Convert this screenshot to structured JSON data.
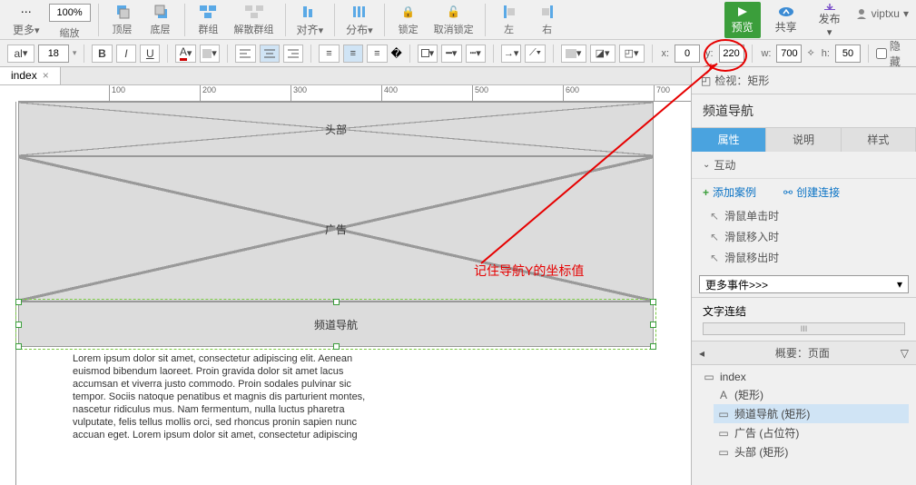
{
  "zoom": "100%",
  "top_toolbar": {
    "more": "更多",
    "scale": "缩放",
    "top": "顶层",
    "bottom": "底层",
    "group": "群组",
    "ungroup": "解散群组",
    "align": "对齐",
    "distribute": "分布",
    "lock": "锁定",
    "unlock": "取消锁定",
    "left": "左",
    "right": "右",
    "preview": "预览",
    "share": "共享",
    "publish": "发布"
  },
  "user": {
    "name": "viptxu"
  },
  "format_bar": {
    "font_style": "al",
    "font_size": "18",
    "x": "0",
    "y": "220",
    "w": "700",
    "h": "50",
    "hide": "隐藏"
  },
  "tab": {
    "name": "index"
  },
  "ruler_ticks": [
    "100",
    "200",
    "300",
    "400",
    "500",
    "600",
    "700"
  ],
  "shapes": {
    "header": "头部",
    "ad": "广告",
    "nav": "频道导航"
  },
  "lorem": "Lorem ipsum dolor sit amet, consectetur adipiscing elit. Aenean euismod bibendum laoreet. Proin gravida dolor sit amet lacus accumsan et viverra justo commodo. Proin sodales pulvinar sic tempor. Sociis natoque penatibus et magnis dis parturient montes, nascetur ridiculus mus. Nam fermentum, nulla luctus pharetra vulputate, felis tellus mollis orci, sed rhoncus pronin sapien nunc accuan eget. Lorem ipsum dolor sit amet, consectetur adipiscing",
  "annotation": "记住导航Y的坐标值",
  "right_panel": {
    "inspect": "检视：矩形",
    "title": "频道导航",
    "tabs": {
      "props": "属性",
      "desc": "说明",
      "style": "样式"
    },
    "interactions": "互动",
    "add_case": "添加案例",
    "create_link": "创建连接",
    "events": {
      "click": "滑鼠单击时",
      "enter": "滑鼠移入时",
      "leave": "滑鼠移出时"
    },
    "more_events": "更多事件>>>",
    "text_link": "文字连结",
    "scroll_label": "III",
    "outline_header": "概要：页面",
    "outline": {
      "root": "index",
      "nav": "频道导航 (矩形)",
      "ad": "广告 (占位符)",
      "header": "头部 (矩形)"
    }
  }
}
